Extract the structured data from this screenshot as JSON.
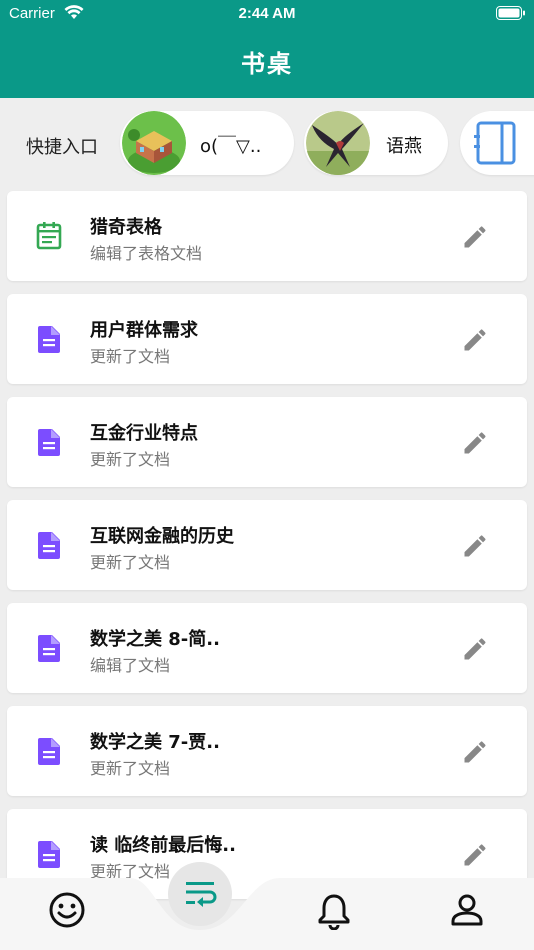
{
  "status_bar": {
    "carrier": "Carrier",
    "time": "2:44 AM"
  },
  "header": {
    "title": "书桌"
  },
  "quick_access": {
    "label": "快捷入口",
    "items": [
      {
        "name": "o(￣▽.."
      },
      {
        "name": "语燕"
      },
      {
        "name": ""
      }
    ]
  },
  "documents": [
    {
      "title": "猎奇表格",
      "subtitle": "编辑了表格文档",
      "icon": "spreadsheet-icon",
      "color": "#34a853"
    },
    {
      "title": "用户群体需求",
      "subtitle": "更新了文档",
      "icon": "document-icon",
      "color": "#7c4dff"
    },
    {
      "title": "互金行业特点",
      "subtitle": "更新了文档",
      "icon": "document-icon",
      "color": "#7c4dff"
    },
    {
      "title": "互联网金融的历史",
      "subtitle": "更新了文档",
      "icon": "document-icon",
      "color": "#7c4dff"
    },
    {
      "title": "数学之美 8-简..",
      "subtitle": "编辑了文档",
      "icon": "document-icon",
      "color": "#7c4dff"
    },
    {
      "title": "数学之美 7-贾..",
      "subtitle": "更新了文档",
      "icon": "document-icon",
      "color": "#7c4dff"
    },
    {
      "title": "读 临终前最后悔..",
      "subtitle": "更新了文档",
      "icon": "document-icon",
      "color": "#7c4dff"
    }
  ],
  "tabbar": {
    "tabs": [
      {
        "icon": "smiley-icon"
      },
      {
        "icon": "wrap-text-icon",
        "active": true
      },
      {
        "icon": "bell-icon"
      },
      {
        "icon": "person-icon"
      }
    ]
  },
  "colors": {
    "primary": "#0a9988",
    "background": "#eeeeee",
    "edit": "#888888"
  }
}
